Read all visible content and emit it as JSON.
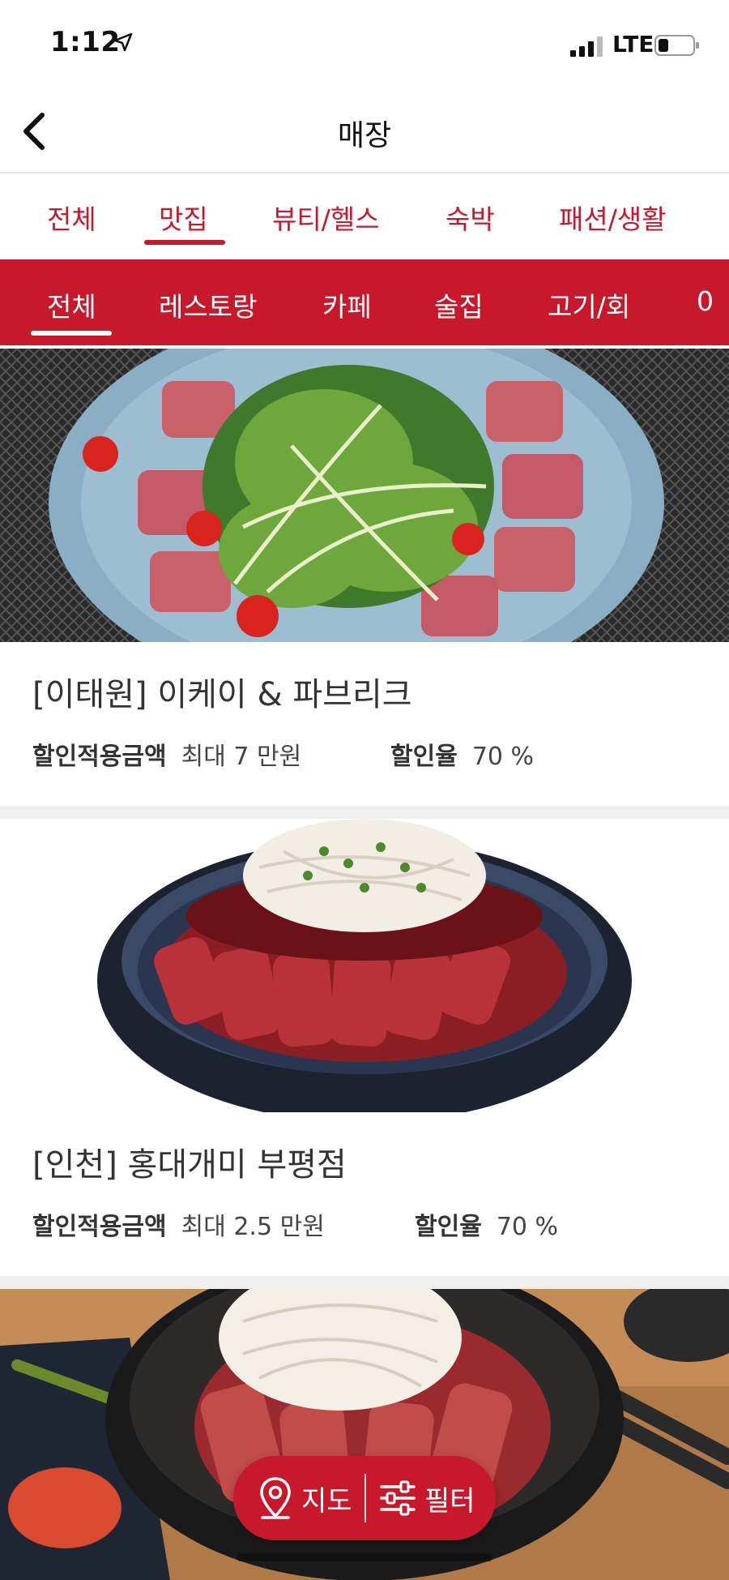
{
  "status_bar": {
    "time": "1:12",
    "network": "LTE"
  },
  "header": {
    "title": "매장",
    "back_icon": "chevron-left-icon"
  },
  "main_tabs": [
    {
      "label": "전체",
      "active": false
    },
    {
      "label": "맛집",
      "active": true
    },
    {
      "label": "뷰티/헬스",
      "active": false
    },
    {
      "label": "숙박",
      "active": false
    },
    {
      "label": "패션/생활",
      "active": false
    }
  ],
  "sub_tabs": [
    {
      "label": "전체",
      "active": true
    },
    {
      "label": "레스토랑",
      "active": false
    },
    {
      "label": "카페",
      "active": false
    },
    {
      "label": "술집",
      "active": false
    },
    {
      "label": "고기/회",
      "active": false
    },
    {
      "label": "0",
      "active": false
    }
  ],
  "listings": [
    {
      "name": "[이태원] 이케이 & 파브리크",
      "amount_label": "할인적용금액",
      "amount_value": "최대 7 만원",
      "rate_label": "할인율",
      "rate_value": "70 %"
    },
    {
      "name": "[인천] 홍대개미 부평점",
      "amount_label": "할인적용금액",
      "amount_value": "최대 2.5 만원",
      "rate_label": "할인율",
      "rate_value": "70 %"
    }
  ],
  "floating_actions": {
    "map_label": "지도",
    "map_icon": "map-pin-icon",
    "filter_label": "필터",
    "filter_icon": "sliders-icon"
  },
  "colors": {
    "brand_red": "#c7182c",
    "separator": "#efefef"
  }
}
